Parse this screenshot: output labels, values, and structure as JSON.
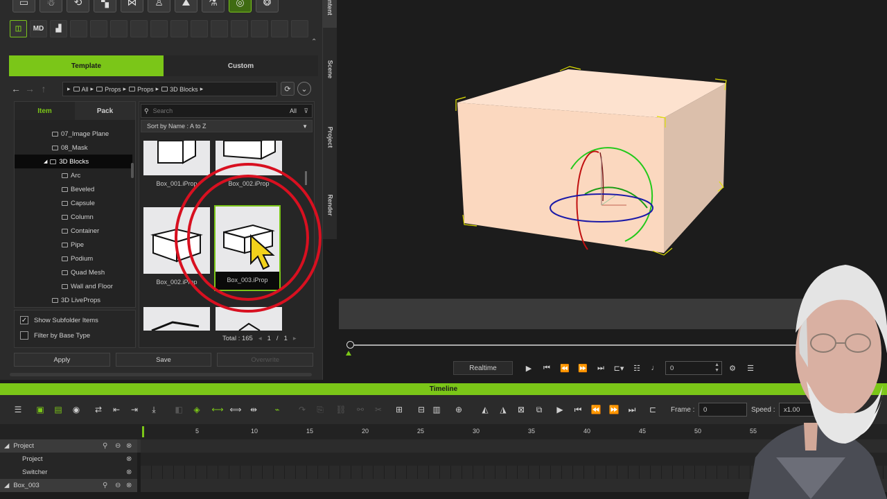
{
  "content_panel": {
    "main_tabs": [
      "Template",
      "Custom"
    ],
    "breadcrumb": [
      "All",
      "Props",
      "Props",
      "3D Blocks"
    ],
    "sub_tabs": [
      "Item",
      "Pack"
    ],
    "tree_items": [
      {
        "label": "07_Image Plane",
        "level": 1
      },
      {
        "label": "08_Mask",
        "level": 1
      },
      {
        "label": "3D Blocks",
        "level": 1,
        "selected": true,
        "expanded": true
      },
      {
        "label": "Arc",
        "level": 2
      },
      {
        "label": "Beveled",
        "level": 2
      },
      {
        "label": "Capsule",
        "level": 2
      },
      {
        "label": "Column",
        "level": 2
      },
      {
        "label": "Container",
        "level": 2
      },
      {
        "label": "Pipe",
        "level": 2
      },
      {
        "label": "Podium",
        "level": 2
      },
      {
        "label": "Quad Mesh",
        "level": 2
      },
      {
        "label": "Wall and Floor",
        "level": 2
      },
      {
        "label": "3D LiveProps",
        "level": 1
      }
    ],
    "options": {
      "show_subfolder": "Show Subfolder Items",
      "show_subfolder_checked": true,
      "filter_base": "Filter by Base Type",
      "filter_base_checked": false
    },
    "search": {
      "placeholder": "Search",
      "scope": "All"
    },
    "sort_label": "Sort by Name : A to Z",
    "thumbnails": [
      {
        "caption": "Box_001.iProp"
      },
      {
        "caption": "Box_002.iProp"
      },
      {
        "caption": "Box_002.iProp"
      },
      {
        "caption": "Box_003.iProp",
        "selected": true
      }
    ],
    "pagination": {
      "total": "Total : 165",
      "page": "1",
      "sep": "/",
      "pages": "1"
    },
    "buttons": {
      "apply": "Apply",
      "save": "Save",
      "overwrite": "Overwrite"
    }
  },
  "side_tabs": [
    "Content",
    "Scene",
    "Project",
    "Render"
  ],
  "playback": {
    "mode": "Realtime",
    "frame": "0"
  },
  "timeline": {
    "title": "Timeline",
    "frame_label": "Frame :",
    "frame_value": "0",
    "speed_label": "Speed :",
    "speed_value": "x1.00",
    "ruler_ticks": [
      "5",
      "10",
      "15",
      "20",
      "25",
      "30",
      "35",
      "40",
      "45",
      "50",
      "55"
    ],
    "rows": [
      "Project",
      "Project",
      "Switcher",
      "Box_003"
    ]
  },
  "colors": {
    "accent": "#7bc618",
    "highlight_circle": "#d81020",
    "box_face": "#fbdcc6"
  }
}
